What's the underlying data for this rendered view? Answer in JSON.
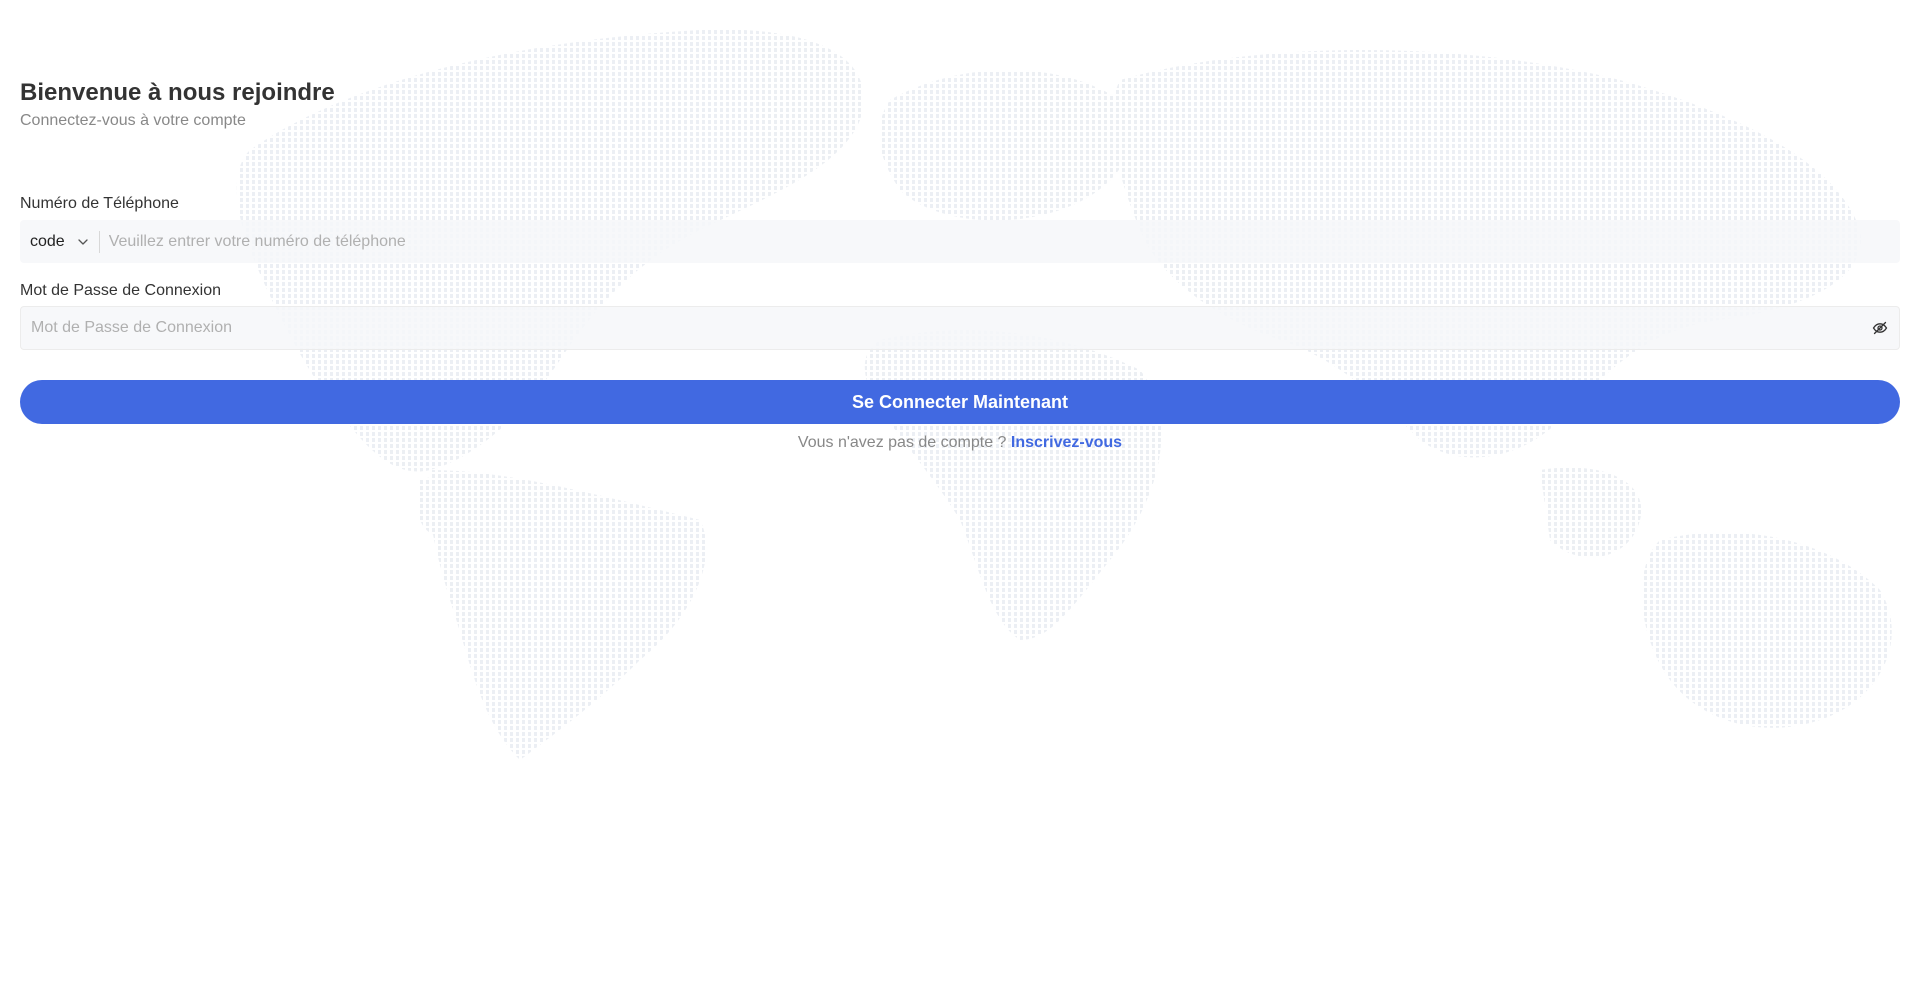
{
  "header": {
    "title": "Bienvenue à nous rejoindre",
    "subtitle": "Connectez-vous à votre compte"
  },
  "phone": {
    "label": "Numéro de Téléphone",
    "code_value": "code",
    "placeholder": "Veuillez entrer votre numéro de téléphone",
    "value": ""
  },
  "password": {
    "label": "Mot de Passe de Connexion",
    "placeholder": "Mot de Passe de Connexion",
    "value": "",
    "toggle_icon": "eye-closed-icon"
  },
  "login": {
    "button_label": "Se Connecter Maintenant"
  },
  "signup": {
    "prompt": "Vous n'avez pas de compte ?",
    "link_label": "Inscrivez-vous"
  },
  "colors": {
    "accent": "#4169e1",
    "field_background": "#f6f7f9",
    "background_map": "#eef1f5"
  }
}
